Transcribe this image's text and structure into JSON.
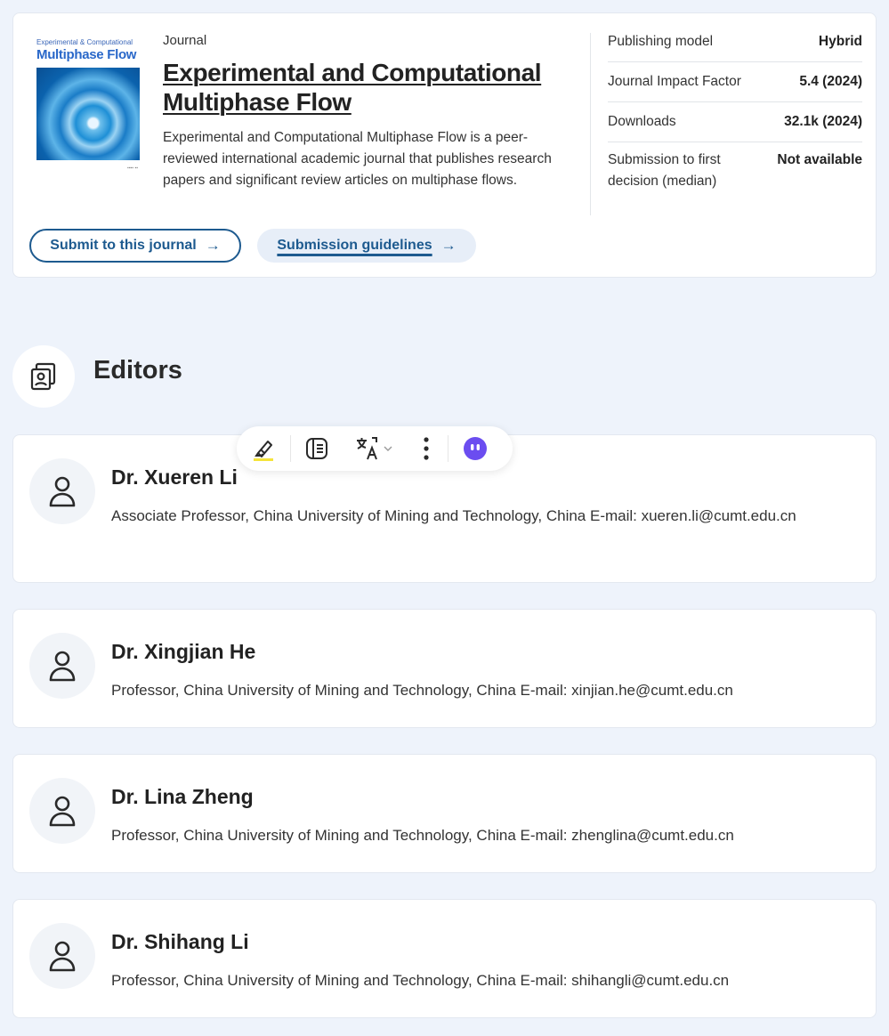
{
  "journal": {
    "cover_top": "Experimental & Computational",
    "cover_title": "Multiphase Flow",
    "label": "Journal",
    "title": "Experimental and Computational Multiphase Flow",
    "description": "Experimental and Computational Multiphase Flow is a peer-reviewed international academic journal that publishes research papers and significant review articles on multiphase flows.",
    "submit_label": "Submit to this journal",
    "guidelines_label": "Submission guidelines",
    "arrow": "→"
  },
  "stats": [
    {
      "key": "Publishing model",
      "value": "Hybrid"
    },
    {
      "key": "Journal Impact Factor",
      "value": "5.4 (2024)"
    },
    {
      "key": "Downloads",
      "value": "32.1k (2024)"
    },
    {
      "key": "Submission to first decision (median)",
      "value": "Not available"
    }
  ],
  "editors_section": {
    "heading": "Editors",
    "icon": "editor-badge-icon"
  },
  "editors": [
    {
      "name": "Dr. Xueren Li",
      "info": "Associate Professor, China University of Mining and Technology, China E-mail: xueren.li@cumt.edu.cn"
    },
    {
      "name": "Dr. Xingjian He",
      "info": "Professor, China University of Mining and Technology, China E-mail: xinjian.he@cumt.edu.cn"
    },
    {
      "name": "Dr. Lina Zheng",
      "info": "Professor, China University of Mining and Technology, China E-mail: zhenglina@cumt.edu.cn"
    },
    {
      "name": "Dr. Shihang Li",
      "info": "Professor, China University of Mining and Technology, China E-mail: shihangli@cumt.edu.cn"
    }
  ],
  "toolbar": {
    "icons": [
      "highlighter-icon",
      "note-icon",
      "translate-icon",
      "more-icon",
      "assistant-icon"
    ],
    "highlight_color": "#f5e43b",
    "assistant_color": "#6b4df0"
  },
  "colors": {
    "accent": "#1d5a8f",
    "background": "#eef3fb"
  }
}
